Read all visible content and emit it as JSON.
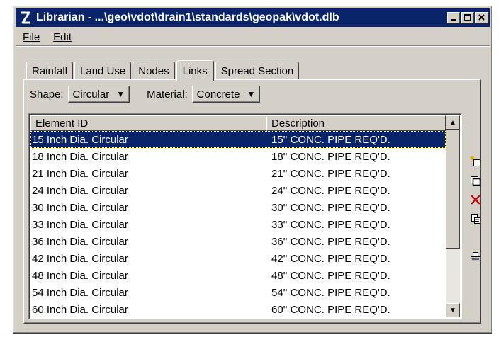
{
  "window": {
    "title": "Librarian - ...\\geo\\vdot\\drain1\\standards\\geopak\\vdot.dlb"
  },
  "menu": {
    "file": "File",
    "edit": "Edit"
  },
  "tabs": [
    {
      "label": "Rainfall",
      "active": false
    },
    {
      "label": "Land Use",
      "active": false
    },
    {
      "label": "Nodes",
      "active": false
    },
    {
      "label": "Links",
      "active": true
    },
    {
      "label": "Spread Section",
      "active": false
    }
  ],
  "filters": {
    "shape_label": "Shape:",
    "shape_value": "Circular",
    "material_label": "Material:",
    "material_value": "Concrete"
  },
  "list": {
    "headers": {
      "id": "Element ID",
      "desc": "Description"
    },
    "selected_index": 0,
    "rows": [
      {
        "id": "15 Inch Dia. Circular",
        "desc": "15'' CONC. PIPE REQ'D."
      },
      {
        "id": "18 Inch Dia. Circular",
        "desc": "18'' CONC. PIPE REQ'D."
      },
      {
        "id": "21 Inch Dia. Circular",
        "desc": "21'' CONC. PIPE REQ'D."
      },
      {
        "id": "24 Inch Dia. Circular",
        "desc": "24'' CONC. PIPE REQ'D."
      },
      {
        "id": "30 Inch Dia. Circular",
        "desc": "30'' CONC. PIPE REQ'D."
      },
      {
        "id": "33 Inch Dia. Circular",
        "desc": "33'' CONC. PIPE REQ'D."
      },
      {
        "id": "36 Inch Dia. Circular",
        "desc": "36'' CONC. PIPE REQ'D."
      },
      {
        "id": "42 Inch Dia. Circular",
        "desc": "42'' CONC. PIPE REQ'D."
      },
      {
        "id": "48 Inch Dia. Circular",
        "desc": "48'' CONC. PIPE REQ'D."
      },
      {
        "id": "54 Inch Dia. Circular",
        "desc": "54'' CONC. PIPE REQ'D."
      },
      {
        "id": "60 Inch Dia. Circular",
        "desc": "60'' CONC. PIPE REQ'D."
      }
    ]
  },
  "colors": {
    "titlebar": "#0a246a",
    "face": "#d4d0c8",
    "selection": "#0a246a"
  },
  "icons": [
    "new-item-icon",
    "copy-item-icon",
    "delete-icon",
    "paste-icon",
    "print-icon"
  ]
}
